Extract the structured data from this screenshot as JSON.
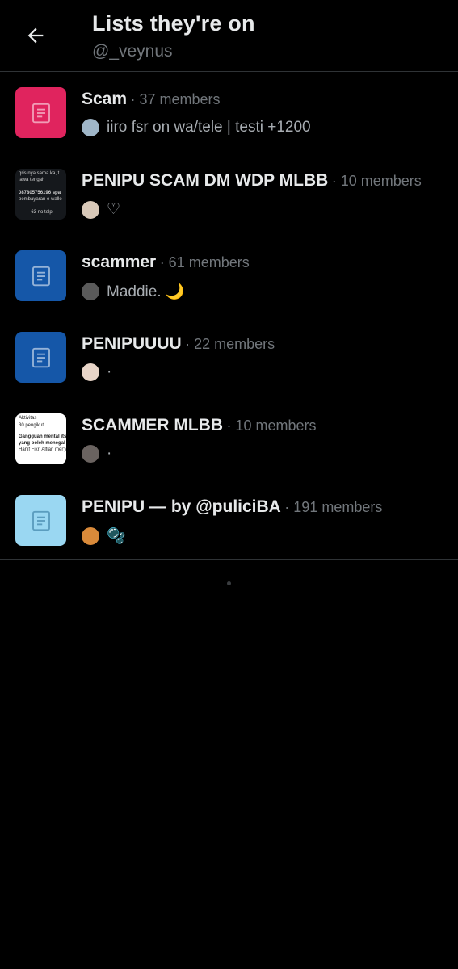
{
  "header": {
    "title": "Lists they're on",
    "handle": "@_veynus"
  },
  "lists": [
    {
      "name": "Scam",
      "members": "· 37 members",
      "owner": "iiro fsr on wa/tele | testi +1200",
      "thumb": "icon",
      "thumb_color": "#e0245e",
      "avatar_color": "#9fb6c8"
    },
    {
      "name": "PENIPU SCAM DM WDP MLBB",
      "members": "· 10 members",
      "owner": "♡",
      "thumb": "dark-shot",
      "thumb_lines": [
        "qris nya sama ka, t",
        "jawa tengah",
        "087805756196 spa",
        "pembayaran e walle",
        "·· ··· ·63 no telp ·"
      ],
      "avatar_color": "#d8c8b8"
    },
    {
      "name": "scammer",
      "members": "· 61 members",
      "owner": "Maddie. 🌙",
      "thumb": "icon",
      "thumb_color": "#1557a8",
      "avatar_color": "#5a5a5a"
    },
    {
      "name": "PENIPUUUU",
      "members": "· 22 members",
      "owner": "·",
      "thumb": "icon",
      "thumb_color": "#1557a8",
      "avatar_color": "#e8d5c8"
    },
    {
      "name": "SCAMMER MLBB",
      "members": "· 10 members",
      "owner": "·",
      "thumb": "light-shot",
      "thumb_lines": [
        "Aktivitas",
        "30 pengikut",
        "Gangguan mental its",
        "yang boleh menegal",
        "Hanif Fikri Alfian mer'y"
      ],
      "avatar_color": "#6a6360"
    },
    {
      "name": "PENIPU — by @puliciBA",
      "members": "· 191 members",
      "owner": "🫧",
      "thumb": "icon",
      "thumb_color": "#9ad7f2",
      "avatar_color": "#d98a3a"
    }
  ],
  "icons": {
    "back": "arrow-left-icon",
    "list": "list-document-icon"
  }
}
